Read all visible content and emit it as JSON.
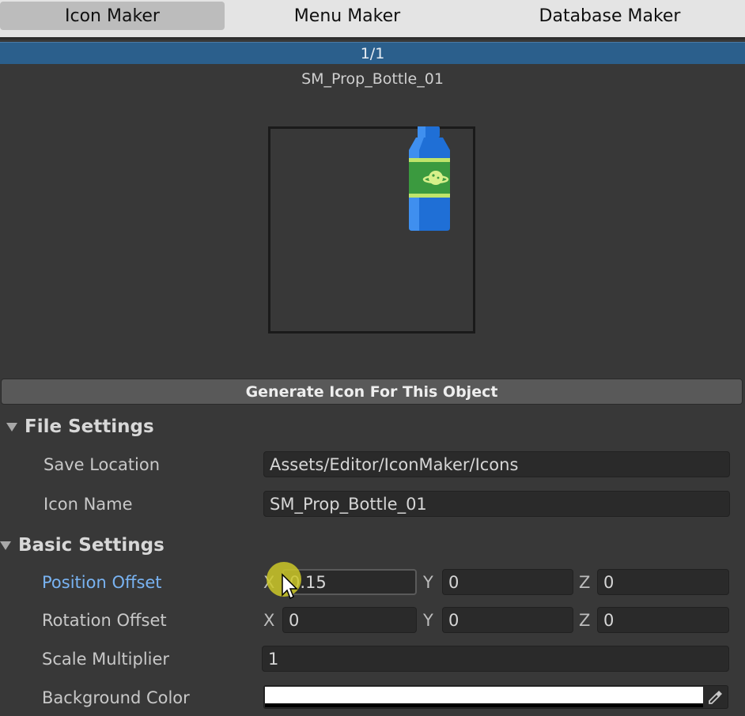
{
  "tabs": [
    {
      "label": "Icon Maker",
      "active": true
    },
    {
      "label": "Menu Maker",
      "active": false
    },
    {
      "label": "Database Maker",
      "active": false
    }
  ],
  "counter": "1/1",
  "object_name": "SM_Prop_Bottle_01",
  "generate_button": "Generate Icon For This Object",
  "file_settings": {
    "title": "File Settings",
    "save_location_label": "Save Location",
    "save_location_value": "Assets/Editor/IconMaker/Icons",
    "icon_name_label": "Icon Name",
    "icon_name_value": "SM_Prop_Bottle_01"
  },
  "basic_settings": {
    "title": "Basic Settings",
    "position_offset": {
      "label": "Position Offset",
      "x": "0.15",
      "y": "0",
      "z": "0"
    },
    "rotation_offset": {
      "label": "Rotation Offset",
      "x": "0",
      "y": "0",
      "z": "0"
    },
    "scale_multiplier": {
      "label": "Scale Multiplier",
      "value": "1"
    },
    "background_color": {
      "label": "Background Color",
      "color": "#ffffff"
    }
  },
  "axes": {
    "x": "X",
    "y": "Y",
    "z": "Z"
  },
  "colors": {
    "accent_blue": "#2b5f8c",
    "highlight_label": "#79b3f2",
    "panel_bg": "#383838"
  }
}
